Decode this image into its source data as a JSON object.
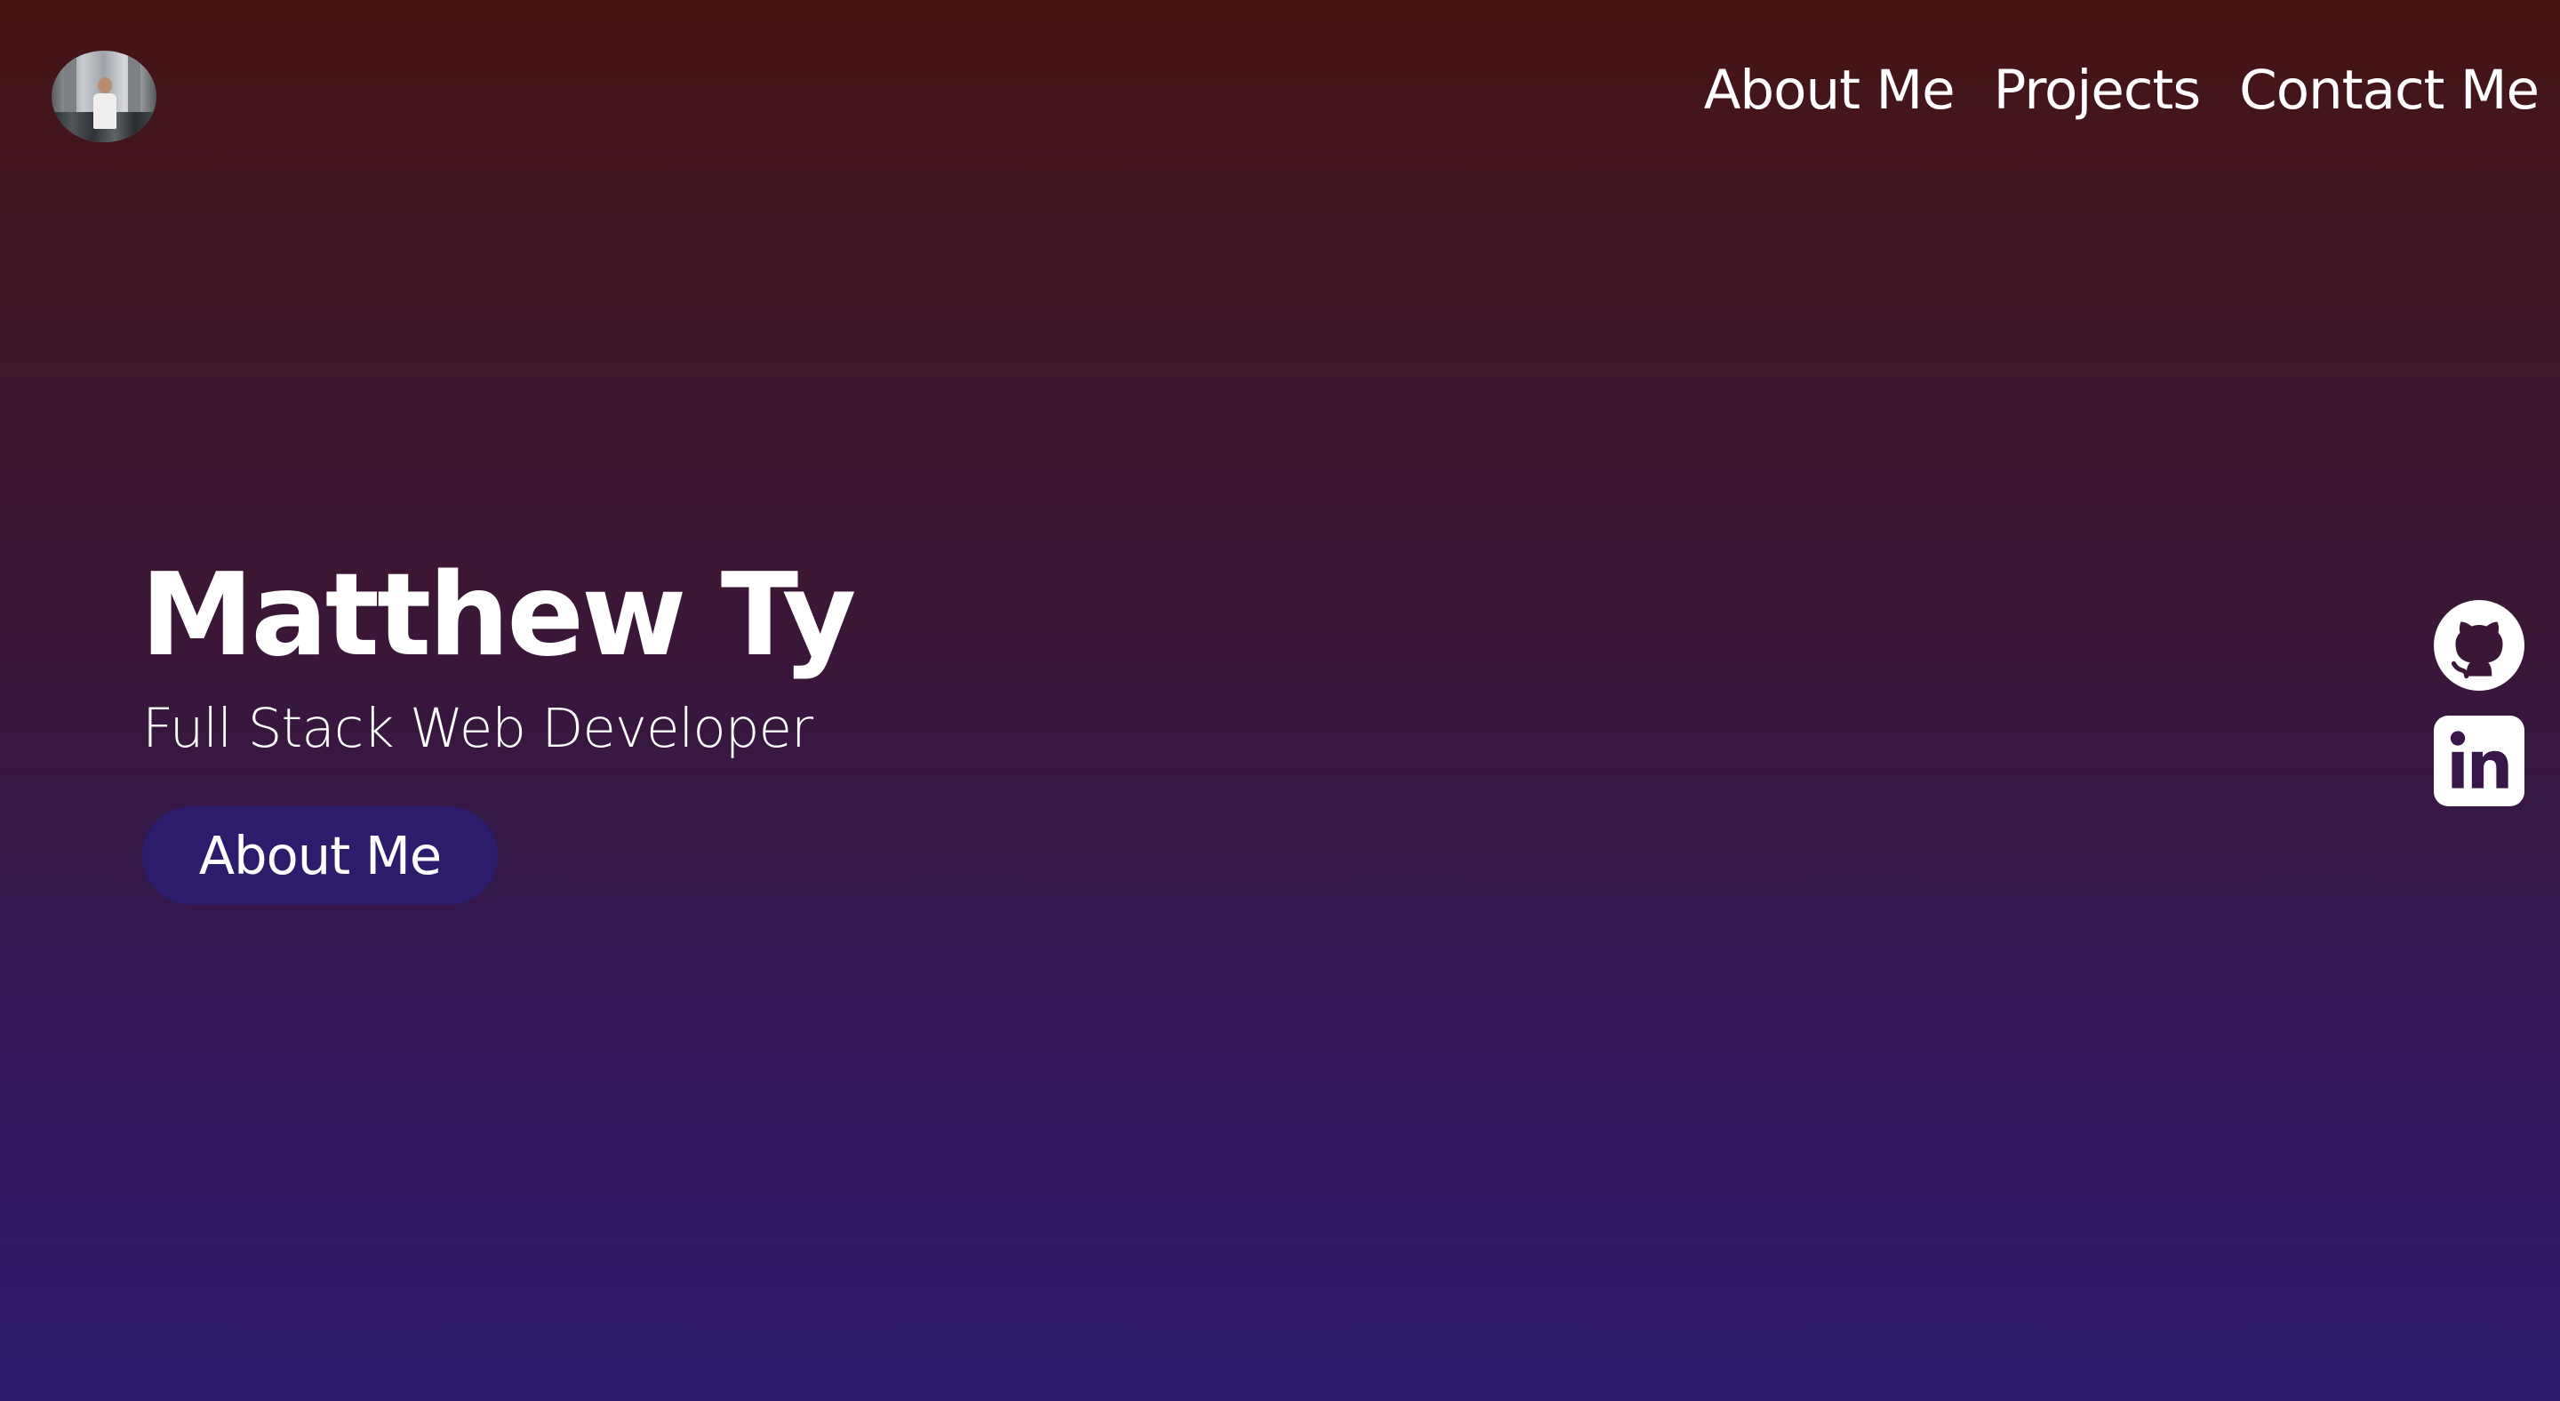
{
  "header": {
    "avatar_alt": "Profile photo",
    "nav": [
      {
        "label": "About Me"
      },
      {
        "label": "Projects"
      },
      {
        "label": "Contact Me"
      }
    ]
  },
  "hero": {
    "name": "Matthew Ty",
    "subtitle": "Full Stack Web Developer",
    "button_label": "About Me"
  },
  "social": [
    {
      "icon": "github-icon"
    },
    {
      "icon": "linkedin-icon"
    }
  ],
  "colors": {
    "gradient_top": "#451414",
    "gradient_bottom": "#2c196d",
    "button_bg": "#2d1b6b",
    "text": "#ffffff"
  }
}
